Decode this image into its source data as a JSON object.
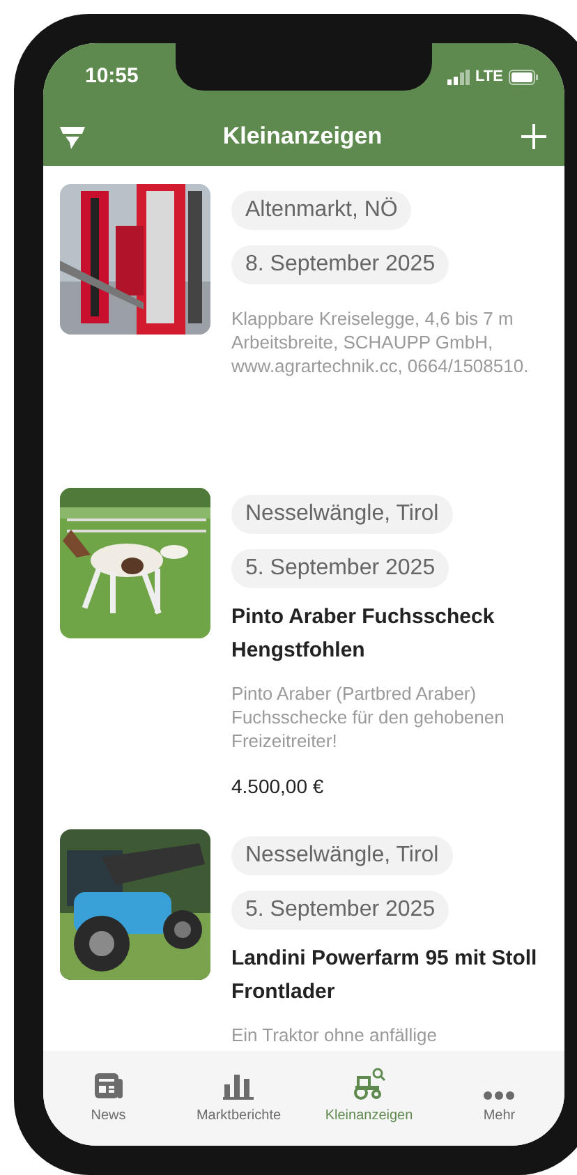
{
  "status_bar": {
    "time": "10:55",
    "network": "LTE"
  },
  "header": {
    "title": "Kleinanzeigen"
  },
  "listings": [
    {
      "location": "Altenmarkt, NÖ",
      "date": "8. September 2025",
      "description": "Klappbare Kreiselegge, 4,6 bis 7 m Arbeitsbreite, SCHAUPP GmbH, www.agrartechnik.cc, 0664/1508510."
    },
    {
      "location": "Nesselwängle, Tirol",
      "date": "5. September 2025",
      "title": "Pinto Araber Fuchsscheck Hengstfohlen",
      "description": "Pinto Araber (Partbred Araber) Fuchsschecke für den gehobenen Freizeitreiter!",
      "price": "4.500,00 €"
    },
    {
      "location": "Nesselwängle, Tirol",
      "date": "5. September 2025",
      "title": "Landini Powerfarm 95 mit Stoll Frontlader",
      "description": "Ein Traktor ohne anfällige"
    }
  ],
  "tab_bar": [
    {
      "label": "News",
      "selected": false
    },
    {
      "label": "Marktberichte",
      "selected": false
    },
    {
      "label": "Kleinanzeigen",
      "selected": true
    },
    {
      "label": "Mehr",
      "selected": false
    }
  ]
}
